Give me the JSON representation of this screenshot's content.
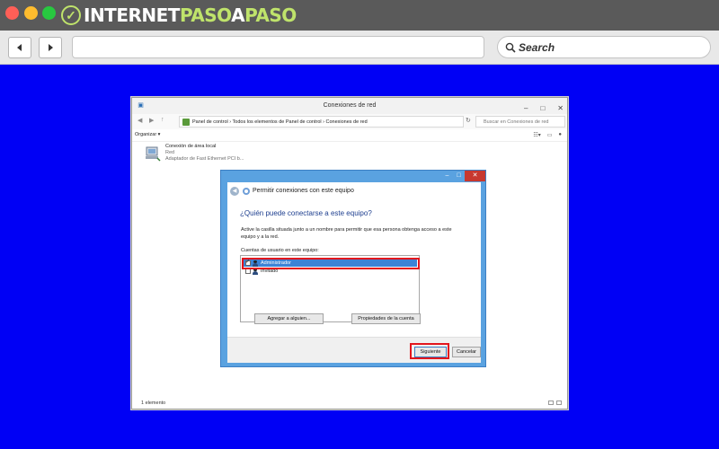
{
  "browser": {
    "logo_text_a": "INTERNET",
    "logo_text_b": "PASO",
    "logo_text_c": "A",
    "logo_text_d": "PASO",
    "search_label": "Search"
  },
  "window": {
    "title": "Conexiones de red",
    "address": "Panel de control  ›  Todos los elementos de Panel de control  ›  Conexiones de red",
    "search_placeholder": "Buscar en Conexiones de red",
    "organize_label": "Organizar ▾",
    "connection": {
      "name": "Conexión de área local",
      "network": "Red",
      "adapter": "Adaptador de Fast Ethernet PCI b..."
    },
    "status": "1 elemento"
  },
  "dialog": {
    "title": "Permitir conexiones con este equipo",
    "question": "¿Quién puede conectarse a este equipo?",
    "description": "Active la casilla situada junto a un nombre para permitir que esa persona obtenga acceso a este equipo y a la red.",
    "list_label": "Cuentas de usuario en este equipo:",
    "accounts": [
      {
        "name": "Administrador",
        "checked": true
      },
      {
        "name": "Invitado",
        "checked": false
      }
    ],
    "add_button": "Agregar a alguien...",
    "props_button": "Propiedades de la cuenta",
    "next_button": "Siguiente",
    "cancel_button": "Cancelar"
  },
  "colors": {
    "background": "#0000f5",
    "dialog_frame": "#5aa2e0",
    "selection": "#3c83d6",
    "highlight": "#e3161d"
  }
}
